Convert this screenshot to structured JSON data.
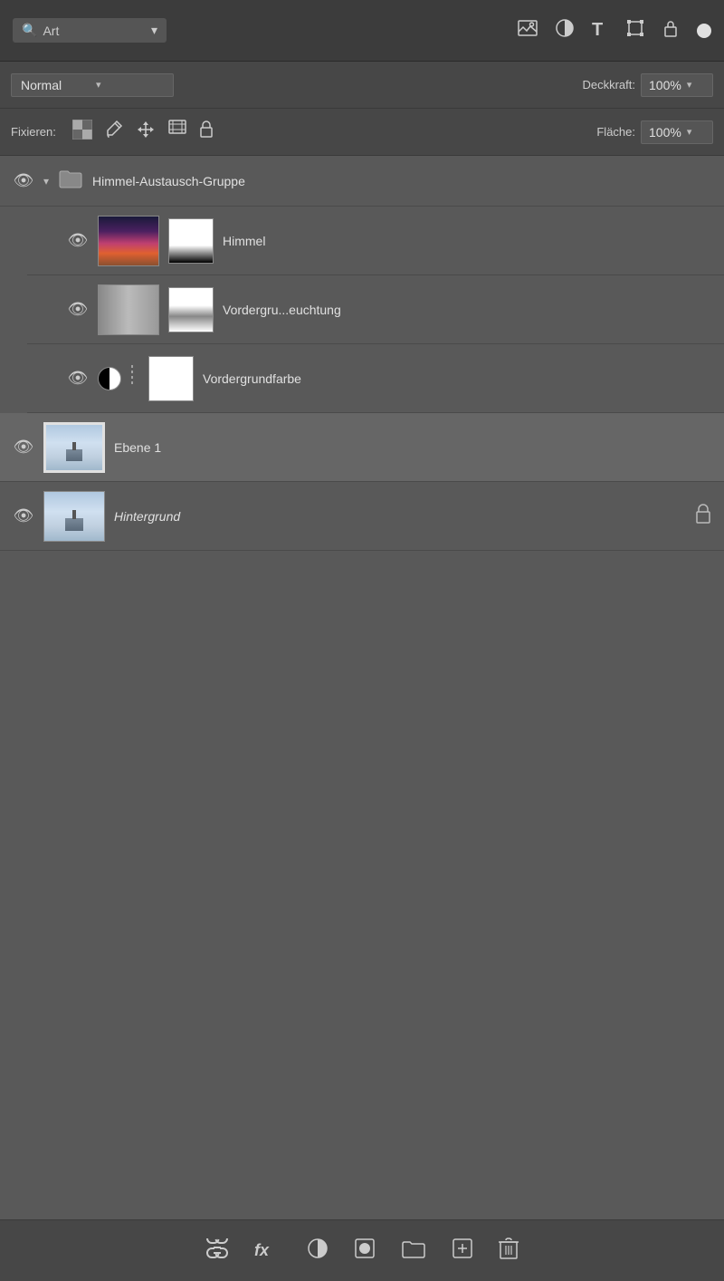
{
  "topbar": {
    "search_placeholder": "Art",
    "search_arrow": "▾",
    "icons": [
      "image-icon",
      "circle-half-icon",
      "type-icon",
      "transform-icon",
      "artboard-icon"
    ]
  },
  "blend_mode": {
    "label": "Normal",
    "arrow": "▾",
    "opacity_label": "Deckkraft:",
    "opacity_value": "100%",
    "opacity_arrow": "▾"
  },
  "lock_row": {
    "label": "Fixieren:",
    "fill_label": "Fläche:",
    "fill_value": "100%",
    "fill_arrow": "▾"
  },
  "layers": {
    "group": {
      "name": "Himmel-Austausch-Gruppe",
      "visible": true
    },
    "items": [
      {
        "name": "Himmel",
        "type": "image_with_mask",
        "visible": true,
        "active": false
      },
      {
        "name": "Vordergru...euchtung",
        "type": "image_with_mask",
        "visible": true,
        "active": false
      },
      {
        "name": "Vordergrundfarbe",
        "type": "fill_with_mask",
        "visible": true,
        "active": false
      },
      {
        "name": "Ebene 1",
        "type": "image",
        "visible": true,
        "active": true
      },
      {
        "name": "Hintergrund",
        "type": "image_locked",
        "visible": true,
        "active": false
      }
    ]
  },
  "bottom_toolbar": {
    "icons": [
      "link-icon",
      "fx-icon",
      "circle-fill-icon",
      "circle-half-icon",
      "folder-icon",
      "add-icon",
      "trash-icon"
    ]
  }
}
